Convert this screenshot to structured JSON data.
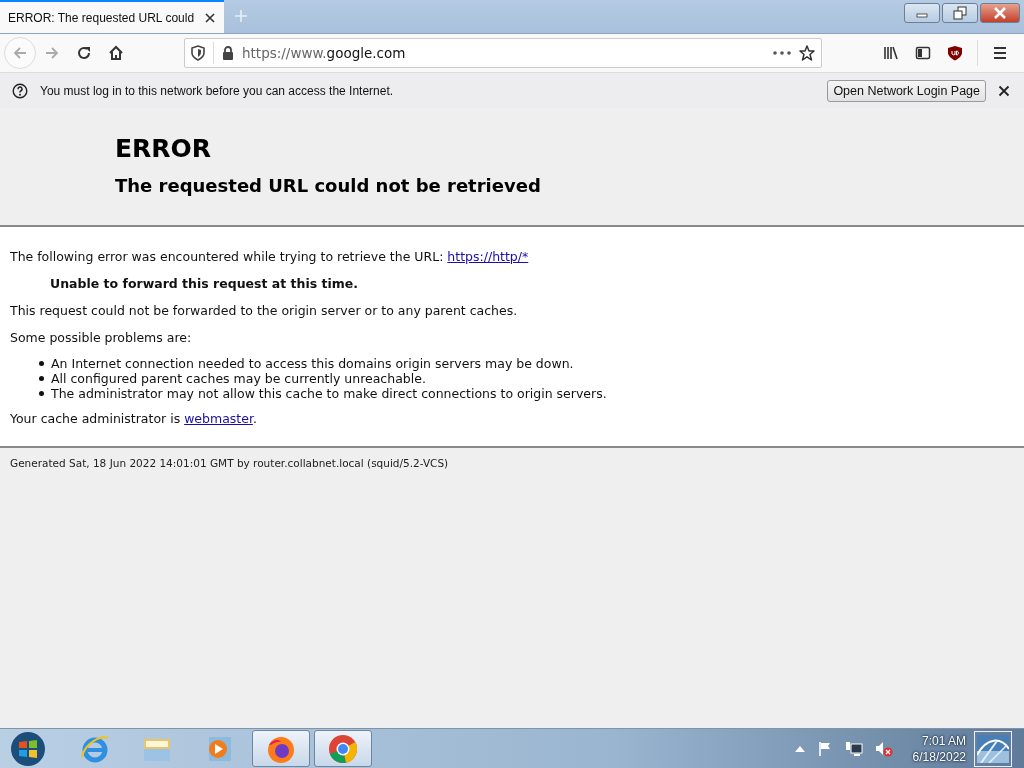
{
  "tabs": [
    {
      "title": "ERROR: The requested URL could",
      "selected": true
    }
  ],
  "toolbar": {
    "url_scheme": "https://www.",
    "url_host": "google.com"
  },
  "notification": {
    "message": "You must log in to this network before you can access the Internet.",
    "button": "Open Network Login Page"
  },
  "page": {
    "title": "ERROR",
    "subtitle": "The requested URL could not be retrieved",
    "intro": "The following error was encountered while trying to retrieve the URL: ",
    "intro_link": "https://http/*",
    "error": "Unable to forward this request at this time.",
    "explanation": "This request could not be forwarded to the origin server or to any parent caches.",
    "problems_heading": "Some possible problems are:",
    "problems": [
      "An Internet connection needed to access this domains origin servers may be down.",
      "All configured parent caches may be currently unreachable.",
      "The administrator may not allow this cache to make direct connections to origin servers."
    ],
    "admin_text": "Your cache administrator is ",
    "admin_link": "webmaster",
    "admin_end": ".",
    "footer": "Generated Sat, 18 Jun 2022 14:01:01 GMT by router.collabnet.local (squid/5.2-VCS)"
  },
  "taskbar": {
    "apps": [
      {
        "kind": "ie",
        "running": false
      },
      {
        "kind": "folder",
        "running": false
      },
      {
        "kind": "media",
        "running": false
      },
      {
        "kind": "firefox",
        "running": true
      },
      {
        "kind": "chrome",
        "running": true
      }
    ],
    "time": "7:01 AM",
    "date": "6/18/2022"
  }
}
